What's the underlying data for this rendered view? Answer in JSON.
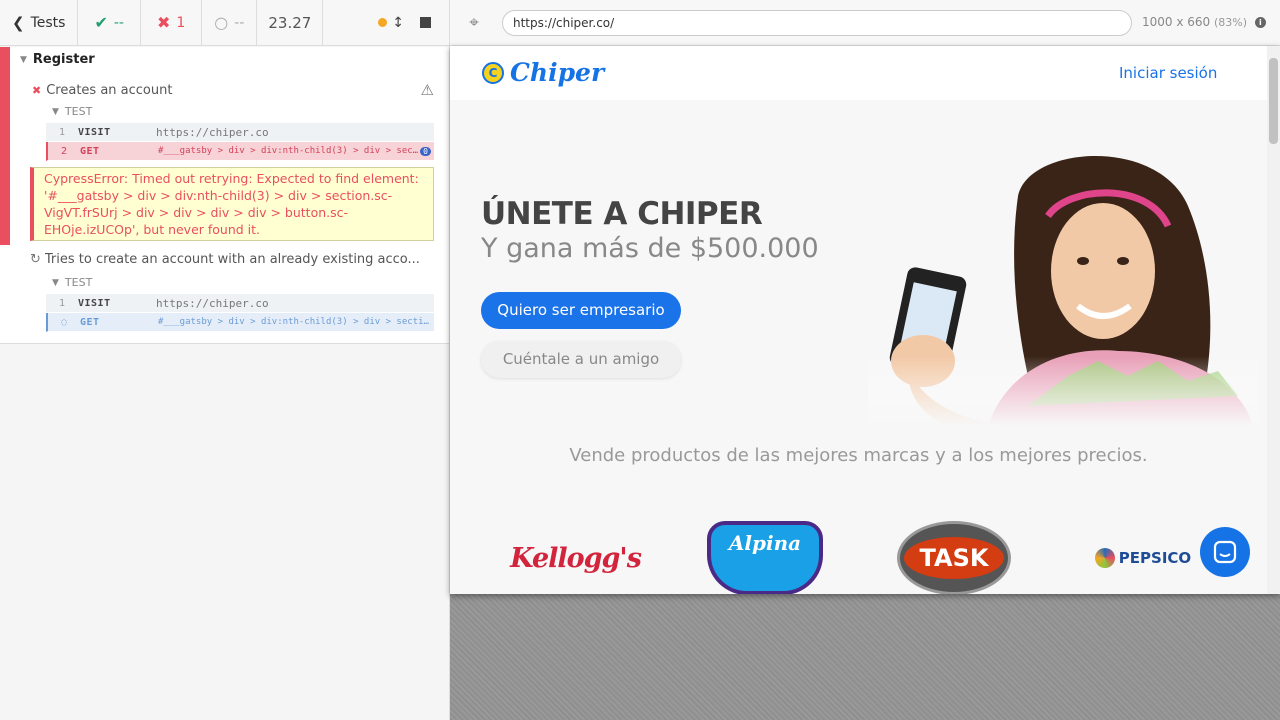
{
  "reporter": {
    "tests_label": "Tests",
    "passed": "--",
    "failed": "1",
    "pending": "--",
    "duration": "23.27",
    "suite": {
      "title": "Register",
      "tests": [
        {
          "title": "Creates an account",
          "state": "failed",
          "section_label": "TEST",
          "commands": [
            {
              "num": "1",
              "name": "VISIT",
              "message": "https://chiper.co"
            },
            {
              "num": "2",
              "name": "GET",
              "message": "#___gatsby > div > div:nth-child(3) > div > section.sc-VigVT.frSUrj > div > div > div > div > button.sc-EHOje.izUCOp",
              "badge": "0"
            }
          ],
          "error": "CypressError: Timed out retrying: Expected to find element: '#___gatsby > div > div:nth-child(3) > div > section.sc-VigVT.frSUrj > div > div > div > div > button.sc-EHOje.izUCOp', but never found it."
        },
        {
          "title": "Tries to create an account with an already existing acco...",
          "state": "running",
          "section_label": "TEST",
          "commands": [
            {
              "num": "1",
              "name": "VISIT",
              "message": "https://chiper.co"
            },
            {
              "num": "",
              "name": "GET",
              "message": "#___gatsby > div > div:nth-child(3) > div > section.sc-VigVT.frSUrj"
            }
          ]
        }
      ]
    }
  },
  "aut": {
    "url": "https://chiper.co/",
    "viewport": "1000 x 660",
    "scale": "(83%)",
    "site": {
      "logo_text": "Chiper",
      "logo_mark": "C",
      "login": "Iniciar sesión",
      "hero_title": "ÚNETE A CHIPER",
      "hero_subtitle": "Y gana más de $500.000",
      "cta_primary": "Quiero ser empresario",
      "cta_secondary": "Cuéntale a un amigo",
      "tagline": "Vende productos de las mejores marcas y a los mejores precios.",
      "brands": [
        "Kellogg's",
        "Alpina",
        "TASK",
        "PEPSICO"
      ]
    }
  },
  "colors": {
    "pass": "#20a06e",
    "fail": "#e94f5f",
    "brand_blue": "#1a73e8",
    "error_bg": "#ffffd2"
  },
  "icons": [
    "chevron-left-icon",
    "check-icon",
    "x-icon",
    "spinner-icon",
    "dot-icon",
    "resize-icon",
    "stop-icon",
    "warning-icon",
    "crosshair-icon",
    "info-icon",
    "chat-icon"
  ]
}
